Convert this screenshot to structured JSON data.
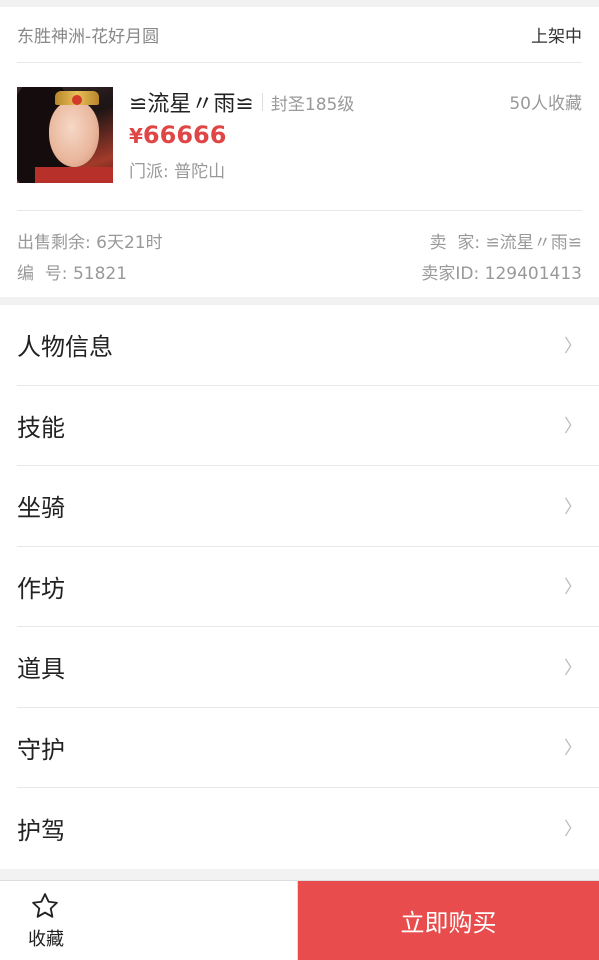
{
  "header": {
    "server": "东胜神洲-花好月圆",
    "status": "上架中"
  },
  "item": {
    "name": "≌流星〃雨≌",
    "level": "封圣185级",
    "favorites": "50人收藏",
    "currency": "¥",
    "price": "66666",
    "school": "门派: 普陀山"
  },
  "meta": {
    "remaining": "出售剩余: 6天21时",
    "seller": "卖  家: ≌流星〃雨≌",
    "serial": "编  号: 51821",
    "seller_id": "卖家ID: 129401413"
  },
  "menu": [
    {
      "label": "人物信息"
    },
    {
      "label": "技能"
    },
    {
      "label": "坐骑"
    },
    {
      "label": "作坊"
    },
    {
      "label": "道具"
    },
    {
      "label": "守护"
    },
    {
      "label": "护驾"
    }
  ],
  "bottom": {
    "favorite_label": "收藏",
    "buy_label": "立即购买"
  },
  "colors": {
    "accent": "#e84c4c",
    "price": "#e04646"
  },
  "icons": {
    "chevron": "chevron-right-icon",
    "star": "star-outline-icon"
  }
}
